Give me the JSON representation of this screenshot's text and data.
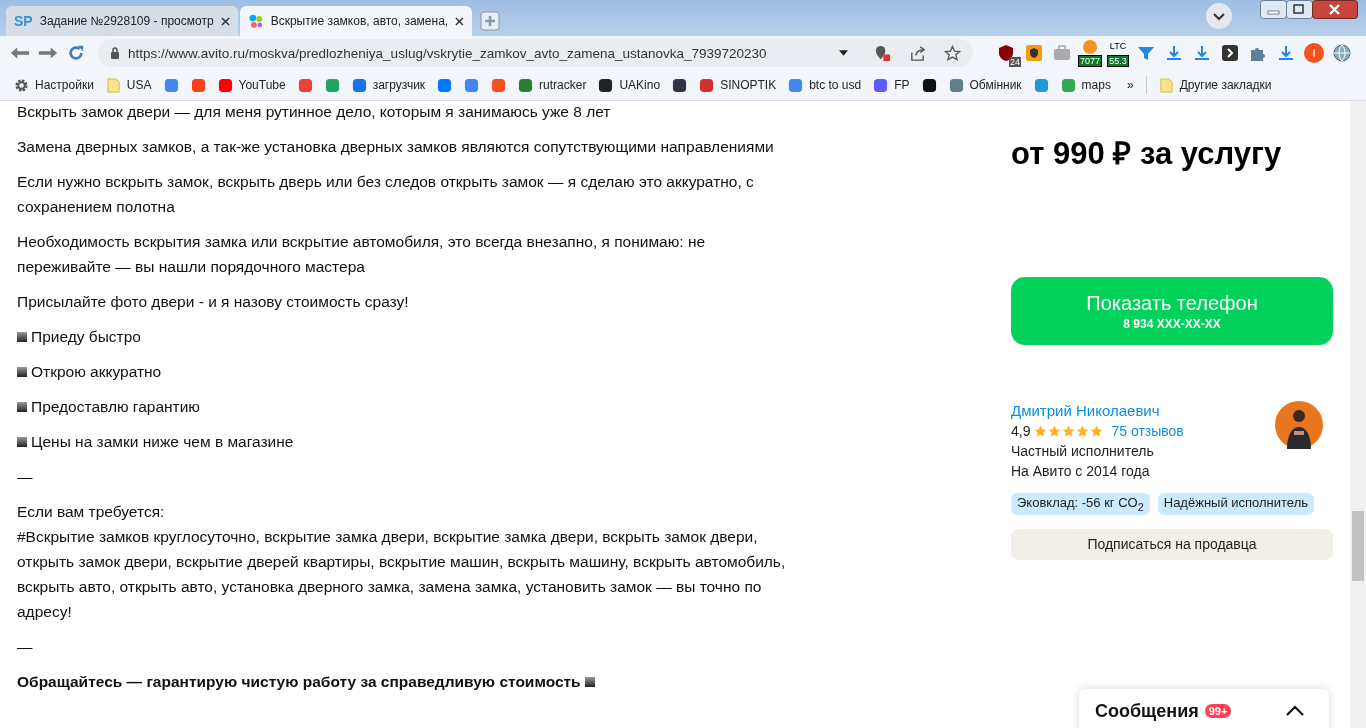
{
  "tabs": [
    {
      "icon_text": "SP",
      "title": "Задание №2928109 - просмотр",
      "selected": false
    },
    {
      "title": "Вскрытие замков, авто, замена,",
      "selected": true
    }
  ],
  "address": {
    "url": "https://www.avito.ru/moskva/predlozheniya_uslug/vskrytie_zamkov_avto_zamena_ustanovka_7939720230"
  },
  "extensions": [
    {
      "kind": "shield",
      "badge": "24"
    },
    {
      "kind": "badge"
    },
    {
      "kind": "case"
    },
    {
      "kind": "coin",
      "badge": "7077"
    },
    {
      "kind": "ticker",
      "label": "LTC",
      "badge": "55.3"
    },
    {
      "kind": "funnel"
    },
    {
      "kind": "download"
    },
    {
      "kind": "download"
    },
    {
      "kind": "bracket"
    },
    {
      "kind": "puzzle"
    },
    {
      "kind": "download"
    },
    {
      "kind": "avatar",
      "label": "I"
    },
    {
      "kind": "globe"
    }
  ],
  "bookmarks": [
    {
      "kind": "gear",
      "label": "Настройки"
    },
    {
      "kind": "folder",
      "label": "USA"
    },
    {
      "kind": "site",
      "color": "#4285f4"
    },
    {
      "kind": "site",
      "color": "#fc3f1d"
    },
    {
      "kind": "site",
      "color": "#ff0000",
      "label": "YouTube"
    },
    {
      "kind": "site",
      "color": "#ea4335"
    },
    {
      "kind": "site",
      "color": "#1fa463"
    },
    {
      "kind": "site",
      "color": "#1a73e8",
      "label": "загрузчик"
    },
    {
      "kind": "site",
      "color": "#0077ff"
    },
    {
      "kind": "site",
      "color": "#4285f4"
    },
    {
      "kind": "site",
      "color": "#f4511e"
    },
    {
      "kind": "site",
      "color": "#2e7d32",
      "label": "rutracker"
    },
    {
      "kind": "site",
      "color": "#222222",
      "label": "UAKino"
    },
    {
      "kind": "site",
      "color": "#333344"
    },
    {
      "kind": "site",
      "color": "#d32f2f",
      "label": "SINOPTIK"
    },
    {
      "kind": "site",
      "color": "#4285f4",
      "label": "btc to usd"
    },
    {
      "kind": "site",
      "color": "#5b5bff",
      "label": "FP"
    },
    {
      "kind": "site",
      "color": "#111111"
    },
    {
      "kind": "site",
      "color": "#607d8b",
      "label": "Обмінник"
    },
    {
      "kind": "site",
      "color": "#1e9bd7"
    },
    {
      "kind": "site",
      "color": "#34a853",
      "label": "maps"
    }
  ],
  "bookmarks_more": "»",
  "other_bookmarks": {
    "kind": "folder",
    "label": "Другие закладки"
  },
  "description": [
    {
      "kind": "para",
      "text": "Вскрыть замок двери — для меня рутинное дело, которым я занимаюсь уже 8 лет"
    },
    {
      "kind": "para",
      "text": "Замена дверных замков, а так-же установка дверных замков являются сопутствующими направлениями"
    },
    {
      "kind": "para",
      "text": "Если нужно вскрыть замок, вскрыть дверь или без следов открыть замок — я сделаю это аккуратно, с сохранением полотна"
    },
    {
      "kind": "para",
      "text": "Необходимость вскрытия замка или вскрытие автомобиля, это всегда внезапно, я понимаю: не переживайте — вы нашли порядочного мастера"
    },
    {
      "kind": "para",
      "text": "Присылайте фото двери - и я назову стоимость сразу!"
    },
    {
      "kind": "bullet",
      "text": "Приеду быстро"
    },
    {
      "kind": "bullet",
      "text": "Открою аккуратно"
    },
    {
      "kind": "bullet",
      "text": "Предоставлю гарантию"
    },
    {
      "kind": "bullet",
      "text": "Цены на замки ниже чем в магазине"
    },
    {
      "kind": "para",
      "text": "—"
    },
    {
      "kind": "para",
      "text": "Если вам требуется:"
    },
    {
      "kind": "tight",
      "text": "#Вскрытие замков круглосуточно, вскрытие замка двери, вскрытие замка двери, вскрыть замок двери, открыть замок двери, вскрытие дверей квартиры, вскрытие машин, вскрыть машину, вскрыть автомобиль, вскрыть авто, открыть авто, установка дверного замка, замена замка, установить замок — вы точно по адресу!"
    },
    {
      "kind": "para",
      "text": "—"
    },
    {
      "kind": "bold",
      "text": "Обращайтесь — гарантирую чистую работу за справедливую стоимость"
    }
  ],
  "price": "от 990 ₽ за услугу",
  "phone_button": {
    "label": "Показать телефон",
    "number": "8 934 XXX-XX-XX"
  },
  "seller": {
    "name": "Дмитрий Николаевич",
    "rating": "4,9",
    "stars": 5,
    "reviews": "75 отзывов",
    "type": "Частный исполнитель",
    "since": "На Авито с 2014 года"
  },
  "tags": [
    "Эковклад: -56 кг CO$_{2}$",
    "Надёжный исполнитель"
  ],
  "subscribe_button": "Подписаться на продавца",
  "messages": {
    "label": "Сообщения",
    "badge": "99+"
  }
}
